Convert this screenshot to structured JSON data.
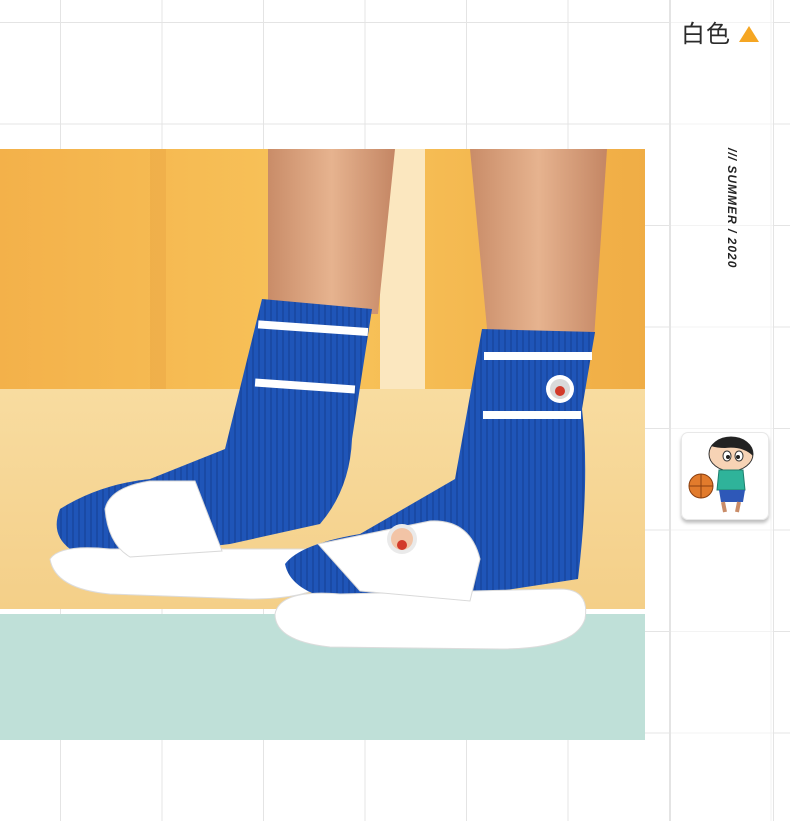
{
  "color_option": {
    "label": "白色",
    "indicator_icon": "triangle-up-icon",
    "indicator_color": "#f5a623"
  },
  "tagline": "/// SUMMER / 2020",
  "photo": {
    "subject": "white slide sandals with blue striped socks"
  },
  "thumbnail": {
    "icon": "cartoon-boy-basketball-icon"
  },
  "colors": {
    "sock_blue": "#1f55b8",
    "backdrop_yellow": "#f7bd4d",
    "floor_mint": "#bfe0d8",
    "sandal_white": "#ffffff"
  }
}
